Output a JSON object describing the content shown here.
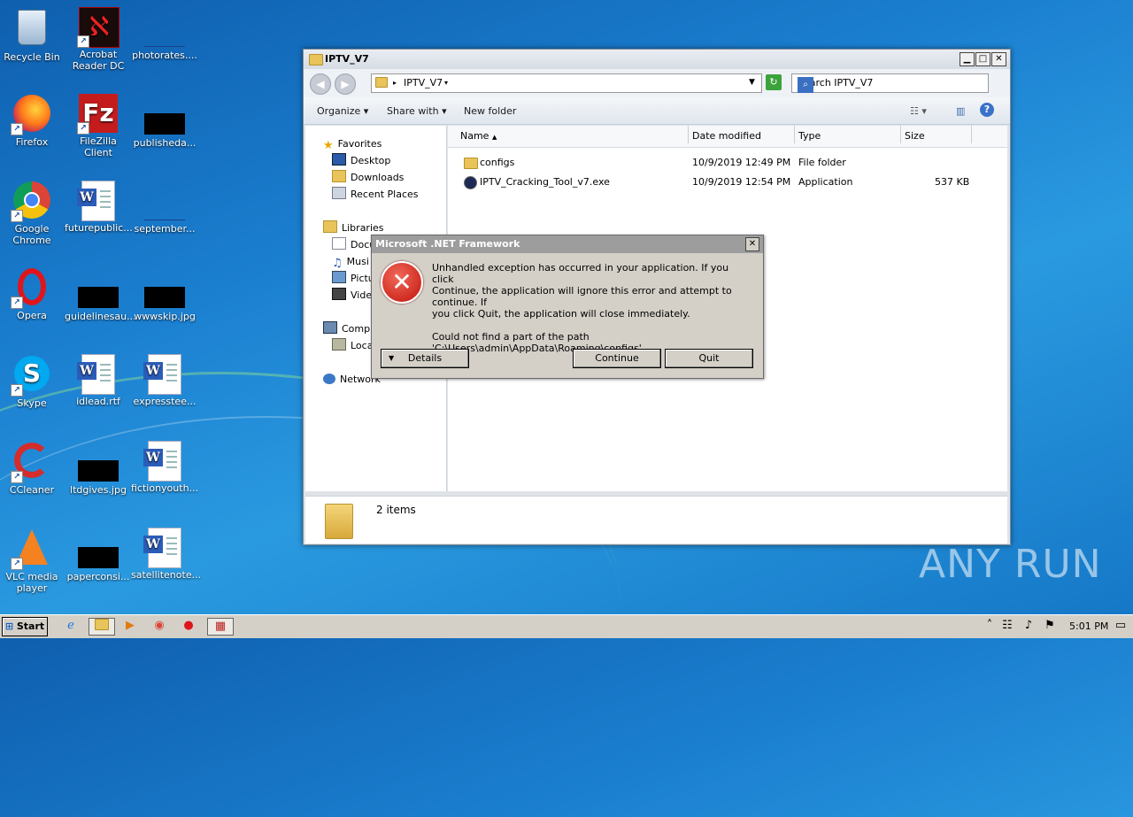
{
  "desktop": {
    "icons": [
      {
        "label": "Recycle Bin"
      },
      {
        "label": "Acrobat Reader DC"
      },
      {
        "label": "photorates...."
      },
      {
        "label": "Firefox"
      },
      {
        "label": "FileZilla Client"
      },
      {
        "label": "publisheda..."
      },
      {
        "label": "Google Chrome"
      },
      {
        "label": "futurepublic..."
      },
      {
        "label": "september..."
      },
      {
        "label": "Opera"
      },
      {
        "label": "guidelinesau..."
      },
      {
        "label": "wwwskip.jpg"
      },
      {
        "label": "Skype"
      },
      {
        "label": "idlead.rtf"
      },
      {
        "label": "expresstee..."
      },
      {
        "label": "CCleaner"
      },
      {
        "label": "ltdgives.jpg"
      },
      {
        "label": "fictionyouth..."
      },
      {
        "label": "VLC media player"
      },
      {
        "label": "paperconsi..."
      },
      {
        "label": "satellitenote..."
      }
    ],
    "watermark": "ANY RUN"
  },
  "explorer": {
    "title": "IPTV_V7",
    "address": "IPTV_V7",
    "search_placeholder": "Search IPTV_V7",
    "toolbar": {
      "organize": "Organize",
      "share": "Share with",
      "new_folder": "New folder"
    },
    "nav": {
      "favorites": "Favorites",
      "desktop": "Desktop",
      "downloads": "Downloads",
      "recent": "Recent Places",
      "libraries": "Libraries",
      "documents": "Docu",
      "music": "Musi",
      "pictures": "Pictu",
      "videos": "Vide",
      "computer": "Compu",
      "local": "Loca",
      "network": "Network"
    },
    "columns": {
      "name": "Name",
      "date": "Date modified",
      "type": "Type",
      "size": "Size"
    },
    "files": [
      {
        "name": "configs",
        "date": "10/9/2019 12:49 PM",
        "type": "File folder",
        "size": ""
      },
      {
        "name": "IPTV_Cracking_Tool_v7.exe",
        "date": "10/9/2019 12:54 PM",
        "type": "Application",
        "size": "537 KB"
      }
    ],
    "status": "2 items"
  },
  "dialog": {
    "title": "Microsoft .NET Framework",
    "message_line1": "Unhandled exception has occurred in your application. If you click",
    "message_line2": "Continue, the application will ignore this error and attempt to continue. If",
    "message_line3": "you click Quit, the application will close immediately.",
    "detail_line1": "Could not find a part of the path",
    "detail_line2": "'C:\\Users\\admin\\AppData\\Roaming\\configs'.",
    "details_button": "Details",
    "continue_button": "Continue",
    "quit_button": "Quit"
  },
  "taskbar": {
    "start": "Start",
    "clock": "5:01 PM"
  }
}
